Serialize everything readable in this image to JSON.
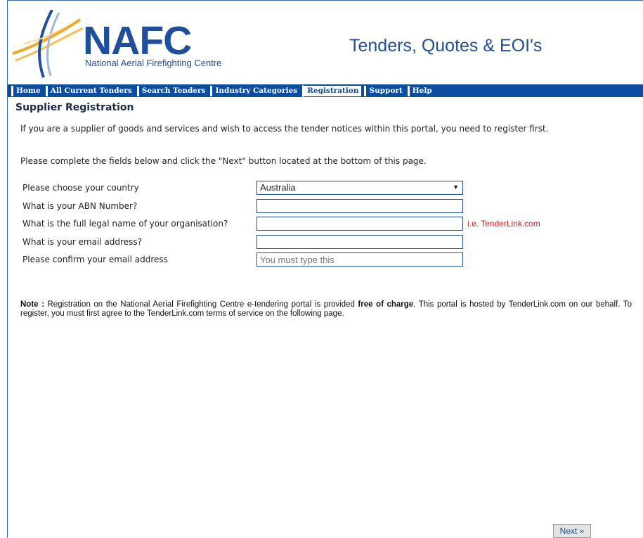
{
  "header": {
    "logo_main": "NAFC",
    "logo_sub": "National Aerial Firefighting Centre",
    "site_title": "Tenders, Quotes & EOI's"
  },
  "nav": {
    "items": [
      {
        "label": "Home",
        "active": false
      },
      {
        "label": "All Current Tenders",
        "active": false
      },
      {
        "label": "Search Tenders",
        "active": false
      },
      {
        "label": "Industry Categories",
        "active": false
      },
      {
        "label": "Registration",
        "active": true
      },
      {
        "label": "Support",
        "active": false
      },
      {
        "label": "Help",
        "active": false
      }
    ]
  },
  "page": {
    "title": "Supplier Registration",
    "intro": "If you are a supplier of goods and services and wish to access the tender notices within this portal, you need to register first.",
    "instruction": "Please complete the fields below and click the \"Next\" button located at the bottom of this page."
  },
  "form": {
    "country": {
      "label": "Please choose your country",
      "value": "Australia"
    },
    "abn": {
      "label": "What is your ABN Number?",
      "value": ""
    },
    "legal_name": {
      "label": "What is the full legal name of your organisation?",
      "value": "",
      "hint": "i.e. TenderLink.com"
    },
    "email": {
      "label": "What is your email address?",
      "value": ""
    },
    "confirm_email": {
      "label": "Please confirm your email address",
      "placeholder": "You must type this"
    }
  },
  "note": {
    "lead": "Note :",
    "text_before": " Registration on the National Aerial Firefighting Centre e-tendering portal is provided ",
    "emphasis": "free of charge",
    "text_after": ". This portal is hosted by TenderLink.com on our behalf. To register, you must first agree to the TenderLink.com terms of service on the following page."
  },
  "actions": {
    "next_label": "Next »"
  },
  "colors": {
    "brand_blue": "#1f4e9c",
    "nav_blue": "#0b4da0",
    "hint_red": "#d81a1a",
    "logo_orange": "#f5a623"
  }
}
